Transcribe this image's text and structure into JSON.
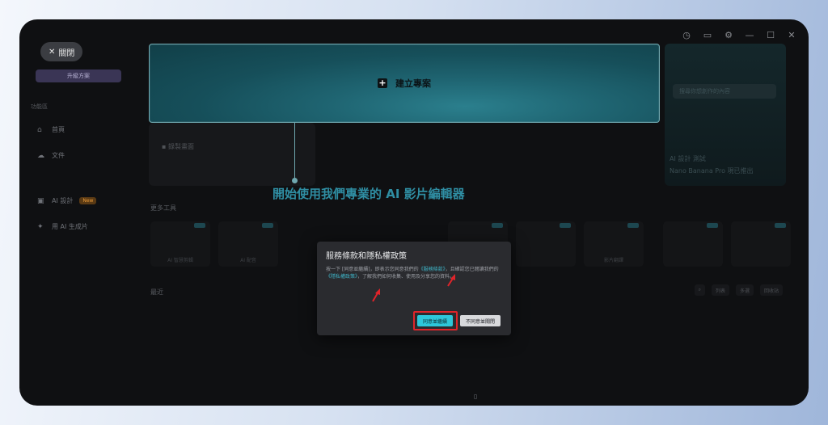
{
  "sidebar": {
    "close_label": "關閉",
    "upgrade_label": "升級方案",
    "section_label": "功能區",
    "items": [
      {
        "label": "首頁",
        "icon": "home-icon"
      },
      {
        "label": "文件",
        "icon": "cloud-icon"
      },
      {
        "label": "AI 設計",
        "icon": "ai-design-icon",
        "badge": "New"
      },
      {
        "label": "用 AI 生成片",
        "icon": "sparkle-icon"
      }
    ]
  },
  "main": {
    "create_project_label": "建立專案",
    "record_label": "錄製畫面",
    "more_tools_label": "更多工具",
    "recent_label": "最近",
    "promo": {
      "search_placeholder": "搜尋你想創作的內容",
      "line1": "AI 設計 測試",
      "line2": "Nano Banana Pro 現已推出"
    },
    "tools": [
      "AI 智慧剪輯",
      "AI 配音",
      "",
      "",
      "",
      "",
      "影片翻譯",
      "",
      ""
    ],
    "toolbar": [
      "列表",
      "多選",
      "回收站"
    ]
  },
  "guide": {
    "title": "開始使用我們專業的 AI 影片編輯器"
  },
  "modal": {
    "title": "服務條款和隱私權政策",
    "body_pre": "按一下 [同意並繼續]，即表示您同意我們的",
    "terms_link": "《服務條款》",
    "body_mid": "，且確認您已閱讀我們的",
    "privacy_link": "《隱私權政策》",
    "body_post": "，了解我們如何收集、使用及分享您的資料。",
    "agree_label": "同意並繼續",
    "disagree_label": "不同意並關閉"
  },
  "colors": {
    "accent": "#2ec7da",
    "highlight": "#e0242a",
    "guide_text": "#2f8ea3"
  }
}
